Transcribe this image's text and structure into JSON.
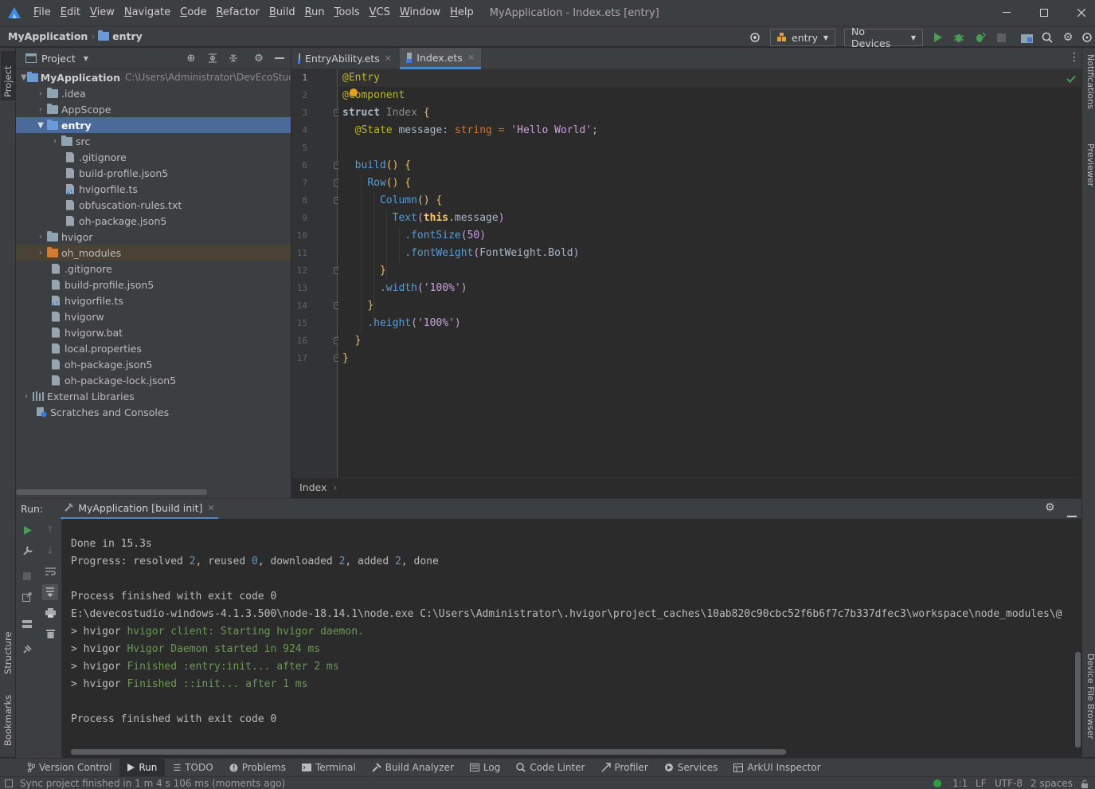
{
  "menubar": {
    "items": [
      "File",
      "Edit",
      "View",
      "Navigate",
      "Code",
      "Refactor",
      "Build",
      "Run",
      "Tools",
      "VCS",
      "Window",
      "Help"
    ],
    "window_title": "MyApplication - Index.ets [entry]"
  },
  "navbar": {
    "project": "MyApplication",
    "module": "entry",
    "run_config": "entry",
    "device": "No Devices"
  },
  "project_panel": {
    "title": "Project",
    "tree": [
      {
        "label": "MyApplication",
        "path": "C:\\Users\\Administrator\\DevEcoStud"
      },
      {
        "label": ".idea"
      },
      {
        "label": "AppScope"
      },
      {
        "label": "entry"
      },
      {
        "label": "src"
      },
      {
        "label": ".gitignore"
      },
      {
        "label": "build-profile.json5"
      },
      {
        "label": "hvigorfile.ts"
      },
      {
        "label": "obfuscation-rules.txt"
      },
      {
        "label": "oh-package.json5"
      },
      {
        "label": "hvigor"
      },
      {
        "label": "oh_modules"
      },
      {
        "label": ".gitignore"
      },
      {
        "label": "build-profile.json5"
      },
      {
        "label": "hvigorfile.ts"
      },
      {
        "label": "hvigorw"
      },
      {
        "label": "hvigorw.bat"
      },
      {
        "label": "local.properties"
      },
      {
        "label": "oh-package.json5"
      },
      {
        "label": "oh-package-lock.json5"
      },
      {
        "label": "External Libraries"
      },
      {
        "label": "Scratches and Consoles"
      }
    ]
  },
  "editor": {
    "tabs": [
      "EntryAbility.ets",
      "Index.ets"
    ],
    "active_tab": "Index.ets",
    "line_numbers": [
      "1",
      "2",
      "3",
      "4",
      "5",
      "6",
      "7",
      "8",
      "9",
      "10",
      "11",
      "12",
      "13",
      "14",
      "15",
      "16",
      "17"
    ],
    "code": {
      "l1": "@Entry",
      "l2a": "@",
      "l2b": "Component",
      "l3a": "struct",
      "l3b": "Index",
      "l3c": "{",
      "l4a": "@State",
      "l4b": "message",
      "l4c": ":",
      "l4d": "string",
      "l4e": "=",
      "l4f": "'Hello World'",
      "l4g": ";",
      "l6a": "build",
      "l6b": "() {",
      "l7a": "Row",
      "l7b": "() {",
      "l8a": "Column",
      "l8b": "() {",
      "l9a": "Text",
      "l9b": "(",
      "l9c": "this",
      "l9d": ".message",
      "l9e": ")",
      "l10a": ".fontSize",
      "l10b": "(",
      "l10c": "50",
      "l10d": ")",
      "l11a": ".fontWeight",
      "l11b": "(",
      "l11c": "FontWeight",
      "l11d": ".Bold",
      "l11e": ")",
      "l12": "}",
      "l13a": ".width",
      "l13b": "(",
      "l13c": "'100%'",
      "l13d": ")",
      "l14": "}",
      "l15a": ".height",
      "l15b": "(",
      "l15c": "'100%'",
      "l15d": ")",
      "l16": "}",
      "l17": "}"
    },
    "breadcrumb": "Index"
  },
  "run_panel": {
    "label": "Run:",
    "tab": "MyApplication [build init]",
    "lines": {
      "c1": "Done in 15.3s",
      "c2a": "Progress: resolved ",
      "c2b": "2",
      "c2c": ", reused ",
      "c2d": "0",
      "c2e": ", downloaded ",
      "c2f": "2",
      "c2g": ", added ",
      "c2h": "2",
      "c2i": ", done",
      "c3": "Process finished with exit code 0",
      "c4": "E:\\devecostudio-windows-4.1.3.500\\node-18.14.1\\node.exe C:\\Users\\Administrator\\.hvigor\\project_caches\\10ab820c90cbc52f6b6f7c7b337dfec3\\workspace\\node_modules\\@",
      "c5a": "> hvigor ",
      "c5b": "hvigor client: Starting hvigor daemon.",
      "c6a": "> hvigor ",
      "c6b": "Hvigor Daemon started in 924 ms",
      "c7a": "> hvigor ",
      "c7b": "Finished :entry:init... after 2 ms",
      "c8a": "> hvigor ",
      "c8b": "Finished ::init... after 1 ms",
      "c9": "Process finished with exit code 0"
    }
  },
  "left_stripe": {
    "project": "Project",
    "structure": "Structure",
    "bookmarks": "Bookmarks"
  },
  "right_stripe": {
    "notifications": "Notifications",
    "previewer": "Previewer",
    "device_file_browser": "Device File Browser"
  },
  "tool_windows": [
    "Version Control",
    "Run",
    "TODO",
    "Problems",
    "Terminal",
    "Build Analyzer",
    "Log",
    "Code Linter",
    "Profiler",
    "Services",
    "ArkUI Inspector"
  ],
  "status": {
    "message": "Sync project finished in 1 m 4 s 106 ms (moments ago)",
    "position": "1:1",
    "line_sep": "LF",
    "encoding": "UTF-8",
    "indent": "2 spaces"
  },
  "colors": {
    "accent": "#4a88c7",
    "selection": "#4a6a9a",
    "run_green": "#499c54"
  }
}
